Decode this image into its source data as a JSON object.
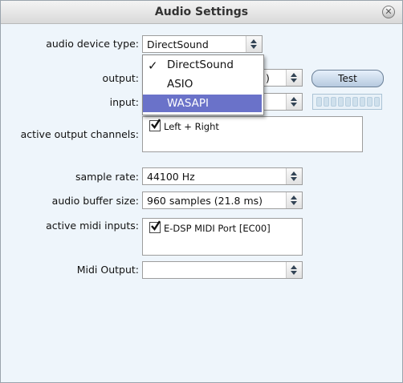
{
  "window": {
    "title": "Audio Settings"
  },
  "labels": {
    "device_type": "audio device type:",
    "output": "output:",
    "input": "input:",
    "active_output_channels": "active output channels:",
    "sample_rate": "sample rate:",
    "buffer_size": "audio buffer size:",
    "active_midi_inputs": "active midi inputs:",
    "midi_output": "Midi Output:"
  },
  "device_type": {
    "value": "DirectSound",
    "options": [
      "DirectSound",
      "ASIO",
      "WASAPI"
    ],
    "checked": "DirectSound",
    "highlighted": "WASAPI"
  },
  "output": {
    "value_suffix": ")"
  },
  "test_button": "Test",
  "output_channels": [
    {
      "label": "Left + Right",
      "checked": true
    }
  ],
  "sample_rate": {
    "value": "44100 Hz"
  },
  "buffer_size": {
    "value": "960 samples (21.8 ms)"
  },
  "midi_inputs": [
    {
      "label": "E-DSP MIDI Port [EC00]",
      "checked": true
    }
  ],
  "midi_output": {
    "value": ""
  },
  "icons": {
    "close": "close-icon",
    "check": "check-icon",
    "updown": "up-down-arrows-icon"
  },
  "colors": {
    "highlight": "#6a72c9",
    "background": "#eef5fb"
  }
}
